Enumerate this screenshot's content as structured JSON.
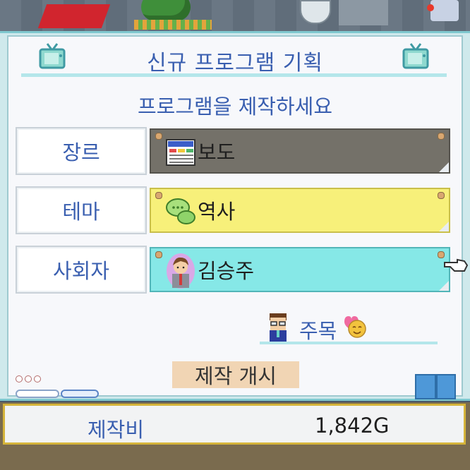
{
  "dialog": {
    "title": "신규 프로그램 기획",
    "subtitle": "프로그램을 제작하세요"
  },
  "fields": [
    {
      "label": "장르",
      "value": "보도",
      "note_color": "#747169",
      "icon": "newspaper-icon"
    },
    {
      "label": "테마",
      "value": "역사",
      "note_color": "#f7f07a",
      "icon": "speech-bubbles-icon"
    },
    {
      "label": "사회자",
      "value": "김승주",
      "note_color": "#86e8e7",
      "icon": "host-portrait-icon"
    }
  ],
  "attention": {
    "label": "주목",
    "icon": "heart-smiley-icon"
  },
  "start_button": {
    "label": "제작 개시"
  },
  "cost": {
    "label": "제작비",
    "value": "1,842G"
  },
  "colors": {
    "accent_text": "#3a5fb0",
    "frame": "#cfe9ec",
    "gold_border": "#d5b43a"
  }
}
